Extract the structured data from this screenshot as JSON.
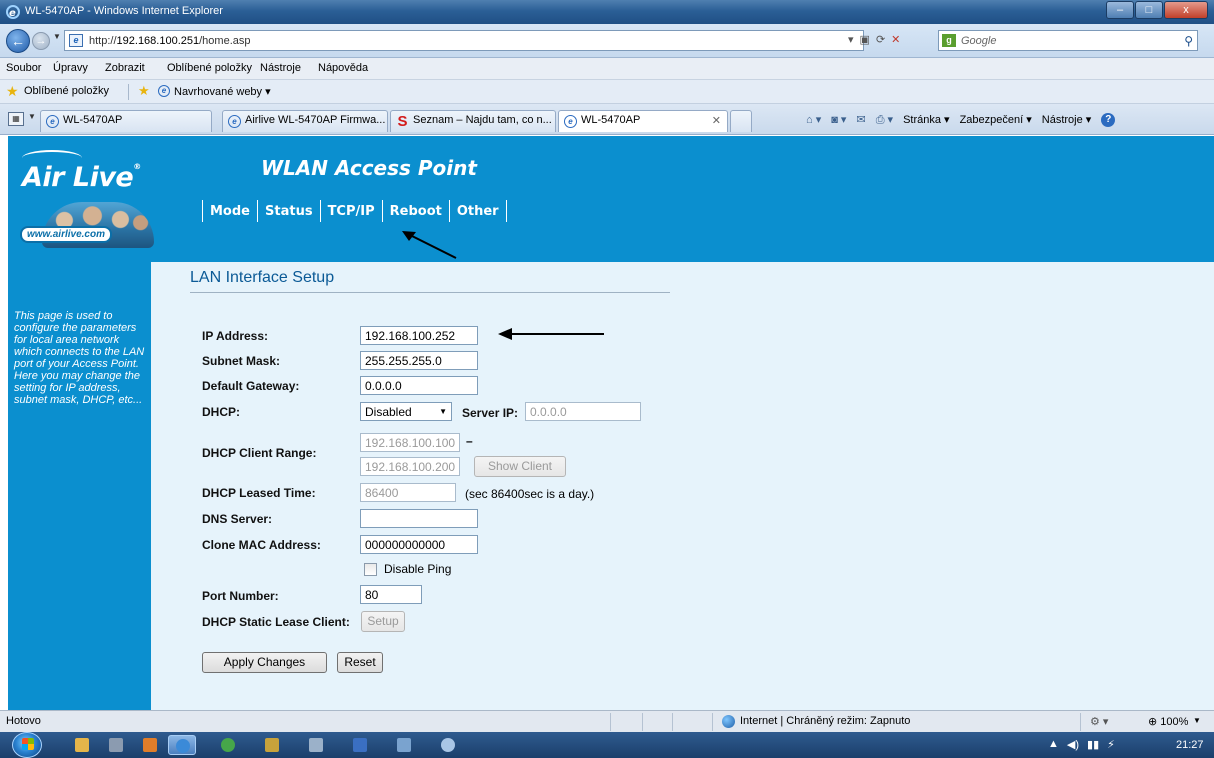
{
  "window": {
    "title": "WL-5470AP - Windows Internet Explorer",
    "minimize": "–",
    "maximize": "□",
    "close": "x"
  },
  "addressbar": {
    "url_prefix": "http://",
    "url_host": "192.168.100.251",
    "url_path": "/home.asp",
    "search_placeholder": "Google"
  },
  "menubar": [
    "Soubor",
    "Úpravy",
    "Zobrazit",
    "Oblíbené položky",
    "Nástroje",
    "Nápověda"
  ],
  "favorites": {
    "label": "Oblíbené položky",
    "suggested": "Navrhované weby ▾"
  },
  "tabs": [
    {
      "label": "WL-5470AP",
      "icon": "ie-icon"
    },
    {
      "label": "Airlive WL-5470AP Firmwa...",
      "icon": "ie-icon"
    },
    {
      "label": "Seznam – Najdu tam, co n...",
      "icon": "seznam-icon"
    },
    {
      "label": "WL-5470AP",
      "icon": "ie-icon",
      "active": true
    }
  ],
  "command_bar": {
    "page": "Stránka ▾",
    "safety": "Zabezpečení ▾",
    "tools": "Nástroje ▾"
  },
  "device": {
    "brand": "Air Live",
    "brand_url": "www.airlive.com",
    "product_title": "WLAN Access Point",
    "menu": [
      "Mode",
      "Status",
      "TCP/IP",
      "Reboot",
      "Other"
    ],
    "sidebar_help": "This page is used to configure the parameters for local area network which connects to the LAN port of your Access Point. Here you may change the setting for IP address, subnet mask, DHCP, etc..."
  },
  "form": {
    "section_title": "LAN Interface Setup",
    "ip_label": "IP Address:",
    "ip_value": "192.168.100.252",
    "mask_label": "Subnet Mask:",
    "mask_value": "255.255.255.0",
    "gateway_label": "Default Gateway:",
    "gateway_value": "0.0.0.0",
    "dhcp_label": "DHCP:",
    "dhcp_value": "Disabled",
    "server_ip_label": "Server IP:",
    "server_ip_value": "0.0.0.0",
    "range_label": "DHCP Client Range:",
    "range_start": "192.168.100.100",
    "range_dash": "–",
    "range_end": "192.168.100.200",
    "show_client": "Show Client",
    "lease_label": "DHCP Leased Time:",
    "lease_value": "86400",
    "lease_note": "(sec 86400sec is a day.)",
    "dns_label": "DNS Server:",
    "dns_value": "",
    "clone_label": "Clone MAC Address:",
    "clone_value": "000000000000",
    "disable_ping": "Disable Ping",
    "port_label": "Port Number:",
    "port_value": "80",
    "static_label": "DHCP Static Lease Client:",
    "setup_button": "Setup",
    "apply_button": "Apply Changes",
    "reset_button": "Reset"
  },
  "statusbar": {
    "status": "Hotovo",
    "zone": "Internet | Chráněný režim: Zapnuto",
    "zoom": "100%"
  },
  "taskbar": {
    "clock": "21:27"
  }
}
